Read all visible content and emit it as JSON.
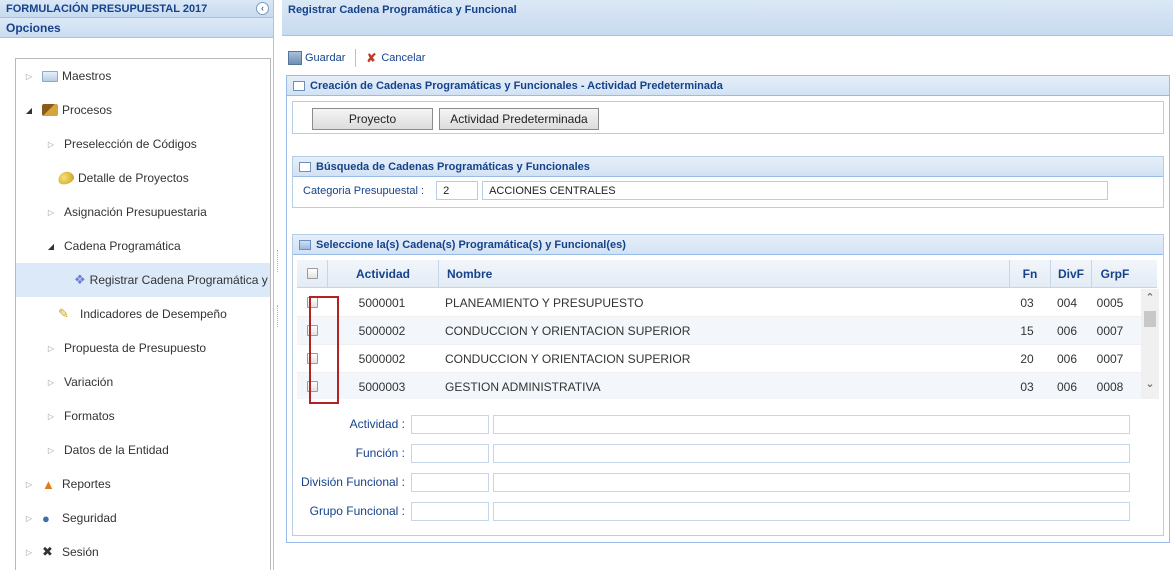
{
  "left_panel": {
    "title": "FORMULACIÓN PRESUPUESTAL 2017",
    "options_label": "Opciones",
    "tree": [
      {
        "label": "Maestros",
        "icon": "folder-icon"
      },
      {
        "label": "Procesos",
        "icon": "book-icon"
      },
      {
        "label": "Preselección de Códigos"
      },
      {
        "label": "Detalle de Proyectos",
        "icon": "egg-icon"
      },
      {
        "label": "Asignación Presupuestaria"
      },
      {
        "label": "Cadena Programática"
      },
      {
        "label": "Registrar Cadena Programática y Fu",
        "icon": "chain-icon"
      },
      {
        "label": "Indicadores de Desempeño",
        "icon": "indicator-icon"
      },
      {
        "label": "Propuesta de Presupuesto"
      },
      {
        "label": "Variación"
      },
      {
        "label": "Formatos"
      },
      {
        "label": "Datos de la Entidad"
      },
      {
        "label": "Reportes",
        "icon": "report-icon"
      },
      {
        "label": "Seguridad",
        "icon": "security-icon"
      },
      {
        "label": "Sesión",
        "icon": "session-icon"
      }
    ]
  },
  "right_panel": {
    "title": "Registrar Cadena Programática y Funcional",
    "toolbar": {
      "save_label": "Guardar",
      "cancel_label": "Cancelar"
    },
    "creation_section": {
      "title": "Creación de Cadenas Programáticas y Funcionales - Actividad Predeterminada",
      "project_button": "Proyecto",
      "default_activity_button": "Actividad Predeterminada"
    },
    "search_section": {
      "title": "Búsqueda de Cadenas Programáticas y Funcionales",
      "category_label": "Categoria Presupuestal :",
      "category_code": "2",
      "category_name": "ACCIONES CENTRALES"
    },
    "grid_section": {
      "title": "Seleccione la(s) Cadena(s) Programática(s) y Funcional(es)",
      "columns": [
        "Actividad",
        "Nombre",
        "Fn",
        "DivF",
        "GrpF"
      ],
      "rows": [
        {
          "actividad": "5000001",
          "nombre": "PLANEAMIENTO Y PRESUPUESTO",
          "fn": "03",
          "divf": "004",
          "grpf": "0005"
        },
        {
          "actividad": "5000002",
          "nombre": "CONDUCCION Y ORIENTACION SUPERIOR",
          "fn": "15",
          "divf": "006",
          "grpf": "0007"
        },
        {
          "actividad": "5000002",
          "nombre": "CONDUCCION Y ORIENTACION SUPERIOR",
          "fn": "20",
          "divf": "006",
          "grpf": "0007"
        },
        {
          "actividad": "5000003",
          "nombre": "GESTION ADMINISTRATIVA",
          "fn": "03",
          "divf": "006",
          "grpf": "0008"
        }
      ]
    },
    "detail_form": {
      "actividad_label": "Actividad :",
      "funcion_label": "Función :",
      "division_label": "División Funcional :",
      "grupo_label": "Grupo Funcional :"
    }
  }
}
